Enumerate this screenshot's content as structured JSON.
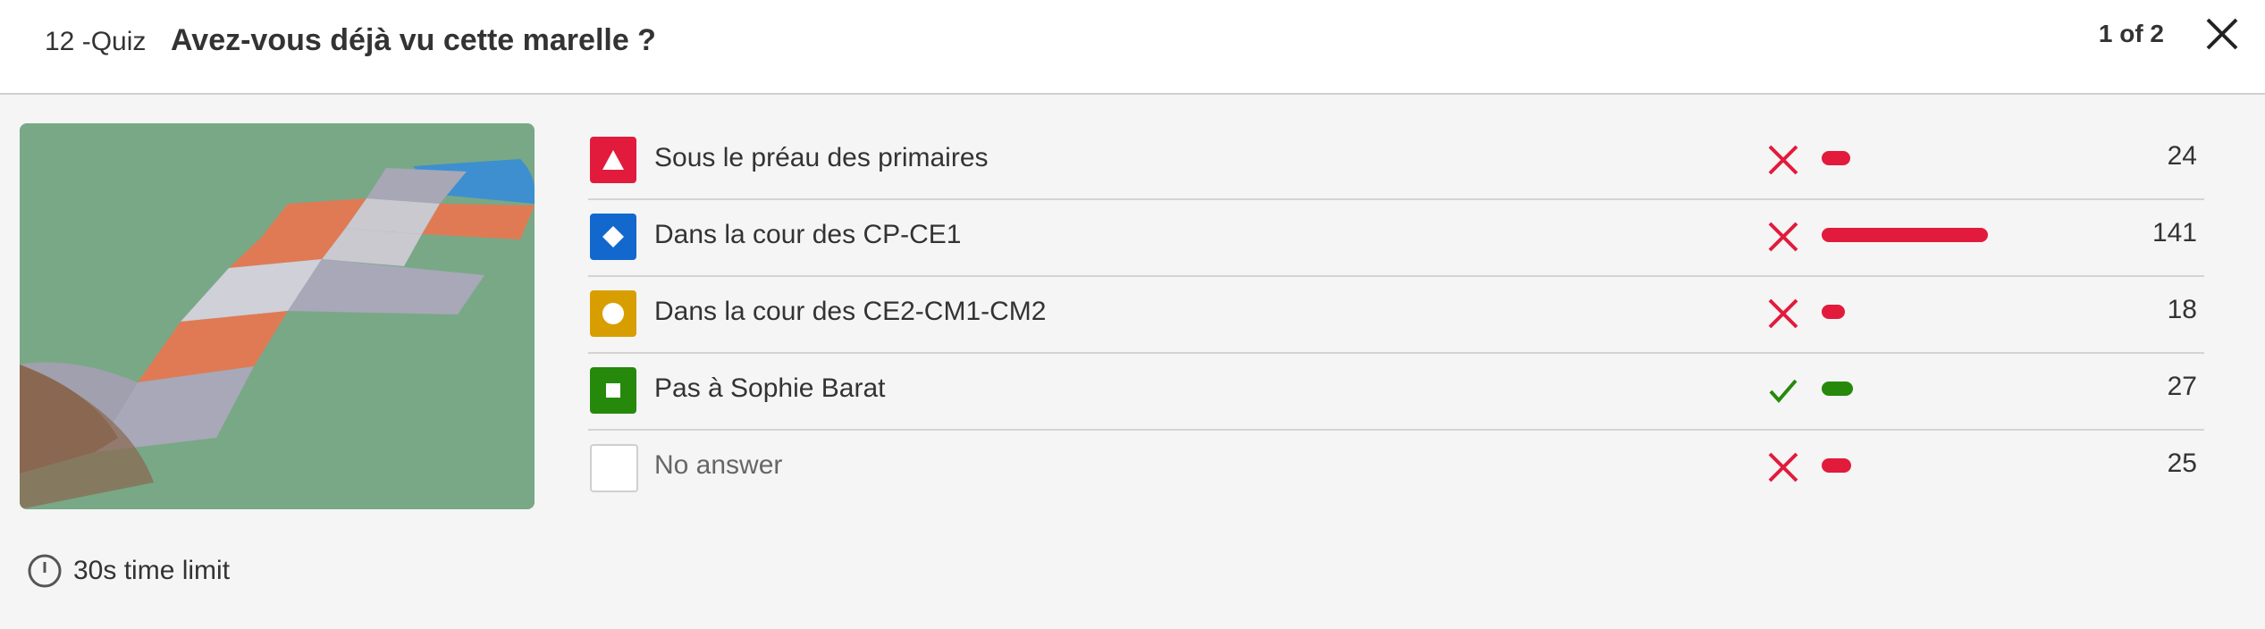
{
  "header": {
    "question_number": "12 -Quiz",
    "question_title": "Avez-vous déjà vu cette marelle ?",
    "counter": "1 of 2",
    "close_icon": "close-icon"
  },
  "image": {
    "description_icon": "hopscotch-photo"
  },
  "time_limit": {
    "label": "30s time limit",
    "icon": "timer-icon"
  },
  "colors": {
    "red": "#e21b3c",
    "blue": "#1368ce",
    "yellow": "#d89e00",
    "green": "#26890c",
    "wrong": "#e21b3c",
    "correct": "#26890c"
  },
  "answers": [
    {
      "shape": "triangle-icon",
      "label": "Sous le préau des primaires",
      "correct": false,
      "count": "24",
      "fraction": 0.17
    },
    {
      "shape": "diamond-icon",
      "label": "Dans la cour des CP-CE1",
      "correct": false,
      "count": "141",
      "fraction": 1.0
    },
    {
      "shape": "circle-icon",
      "label": "Dans la cour des CE2-CM1-CM2",
      "correct": false,
      "count": "18",
      "fraction": 0.13
    },
    {
      "shape": "square-icon",
      "label": "Pas à Sophie Barat",
      "correct": true,
      "count": "27",
      "fraction": 0.19
    },
    {
      "shape": "none",
      "label": "No answer",
      "correct": false,
      "count": "25",
      "fraction": 0.18
    }
  ]
}
